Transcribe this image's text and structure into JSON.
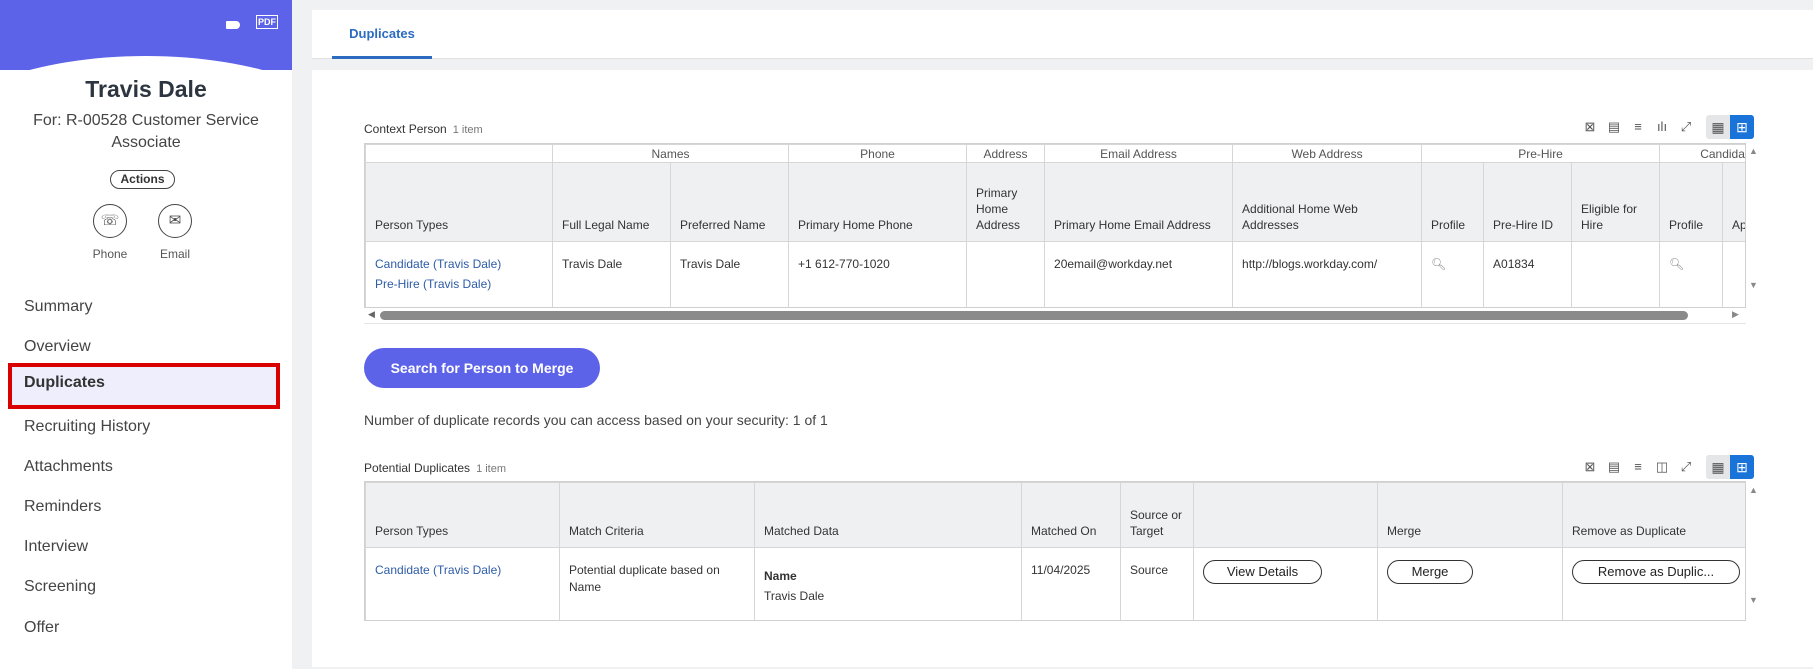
{
  "sidebar": {
    "name": "Travis Dale",
    "subtitle": "For: R-00528 Customer Service Associate",
    "pdf_label": "PDF",
    "actions_label": "Actions",
    "phone_label": "Phone",
    "email_label": "Email",
    "nav": [
      "Summary",
      "Overview",
      "Duplicates",
      "Recruiting History",
      "Attachments",
      "Reminders",
      "Interview",
      "Screening",
      "Offer"
    ],
    "selected": "Duplicates"
  },
  "tabs": {
    "active": "Duplicates"
  },
  "context": {
    "title": "Context Person",
    "count": "1 item",
    "groups": [
      "Names",
      "Phone",
      "Address",
      "Email Address",
      "Web Address",
      "Pre-Hire",
      "Candida"
    ],
    "headers": [
      "Person Types",
      "Full Legal Name",
      "Preferred Name",
      "Primary Home Phone",
      "Primary Home Address",
      "Primary Home Email Address",
      "Additional Home Web Addresses",
      "Profile",
      "Pre-Hire ID",
      "Eligible for Hire",
      "Profile",
      "Ap"
    ],
    "row": {
      "person_types": [
        "Candidate (Travis Dale)",
        "Pre-Hire (Travis Dale)"
      ],
      "full_legal_name": "Travis Dale",
      "preferred_name": "Travis Dale",
      "phone": "+1 612-770-1020",
      "address": "",
      "email": "20email@workday.net",
      "web": "http://blogs.workday.com/",
      "prehire_id": "A01834",
      "eligible": ""
    }
  },
  "search_button": "Search for Person to Merge",
  "security_text": "Number of duplicate records you can access based on your security: 1 of 1",
  "duplicates": {
    "title": "Potential Duplicates",
    "count": "1 item",
    "headers": [
      "Person Types",
      "Match Criteria",
      "Matched Data",
      "Matched On",
      "Source or Target",
      "",
      "Merge",
      "Remove as Duplicate"
    ],
    "row": {
      "person_type": "Candidate (Travis Dale)",
      "criteria": "Potential duplicate based on Name",
      "data_label": "Name",
      "data_value": "Travis Dale",
      "matched_on": "11/04/2025",
      "source": "Source",
      "view_details": "View Details",
      "merge": "Merge",
      "remove": "Remove as Duplic..."
    }
  }
}
